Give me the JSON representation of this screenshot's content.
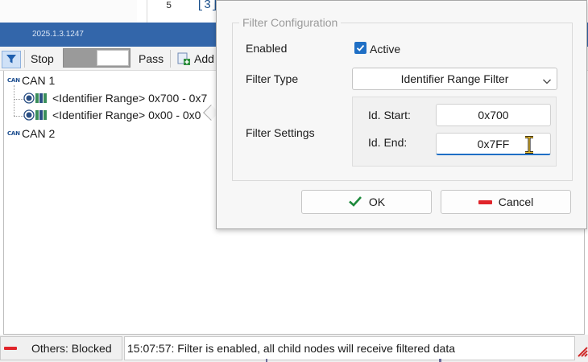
{
  "editor": {
    "line_number": "5",
    "code": "[3]"
  },
  "window": {
    "version": "2025.1.3.1247"
  },
  "toolbar": {
    "stop_label": "Stop",
    "pass_label": "Pass",
    "add_label": "Add"
  },
  "tree": {
    "nodes": [
      {
        "label": "CAN 1",
        "badge": "CAN"
      },
      {
        "label": "<Identifier Range> 0x700 - 0x7"
      },
      {
        "label": "<Identifier Range> 0x00 - 0x0"
      },
      {
        "label": "CAN 2",
        "badge": "CAN"
      }
    ]
  },
  "popup": {
    "group_title": "Filter Configuration",
    "enabled_label": "Enabled",
    "active_label": "Active",
    "active_checked": true,
    "filter_type_label": "Filter Type",
    "filter_type_value": "Identifier Range Filter",
    "filter_settings_label": "Filter Settings",
    "id_start_label": "Id. Start:",
    "id_start_value": "0x700",
    "id_end_label": "Id. End:",
    "id_end_value": "0x7FF",
    "ok_label": "OK",
    "cancel_label": "Cancel"
  },
  "status": {
    "others_label": "Others: Blocked",
    "message": "15:07:57: Filter is enabled, all child nodes will receive filtered data"
  },
  "colors": {
    "titlebar": "#3366aa",
    "accent": "#1f6fc5",
    "ok_check": "#1e8a3c",
    "cancel_red": "#e0242a"
  }
}
